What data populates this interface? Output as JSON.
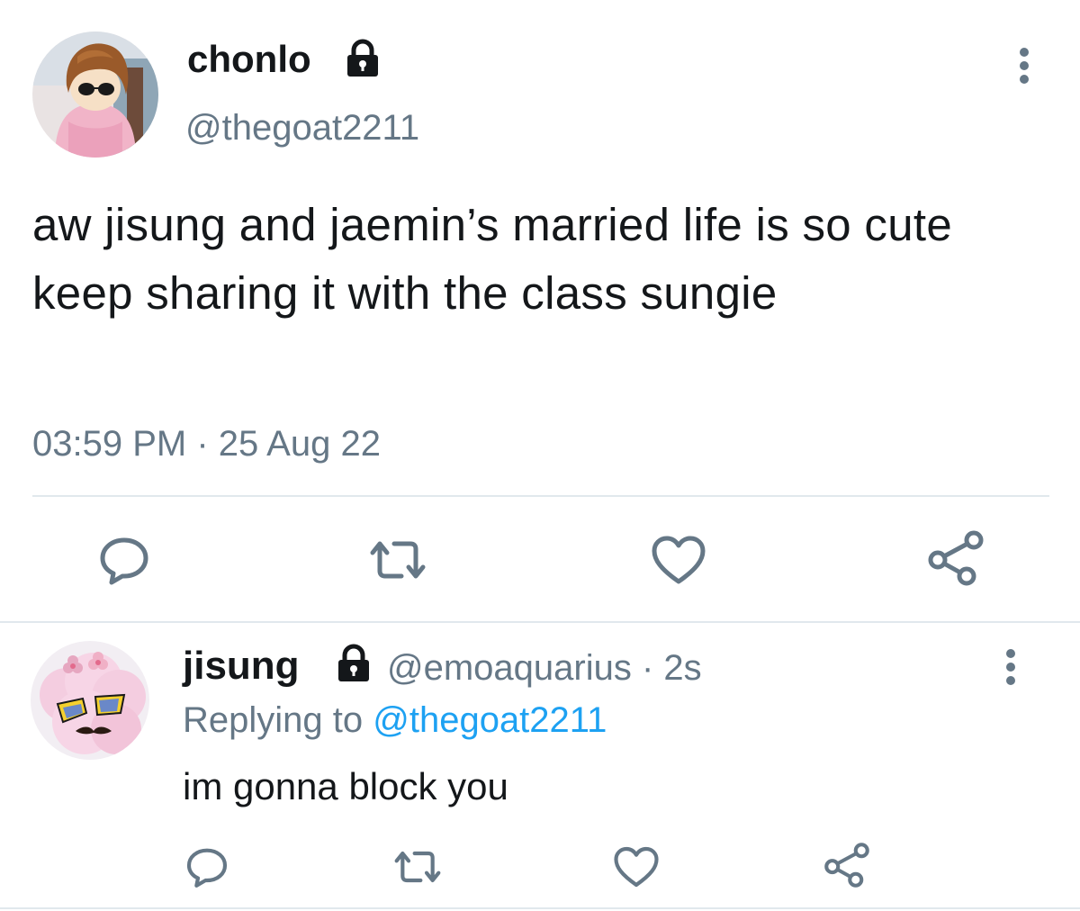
{
  "main_tweet": {
    "display_name": "chonlo",
    "handle": "@thegoat2211",
    "locked_icon": "lock-icon",
    "text": "aw jisung and jaemin’s married life is so cute keep sharing it with the class sungie",
    "timestamp": "03:59 PM · 25 Aug 22",
    "actions": [
      "reply-icon",
      "retweet-icon",
      "like-icon",
      "share-icon"
    ]
  },
  "reply_tweet": {
    "display_name": "jisung",
    "handle_time": "@emoaquarius · 2s",
    "locked_icon": "lock-icon",
    "replying_prefix": "Replying to ",
    "replying_mention": "@thegoat2211",
    "text": "im gonna block you",
    "actions": [
      "reply-icon",
      "retweet-icon",
      "like-icon",
      "share-icon"
    ]
  },
  "colors": {
    "text": "#14171a",
    "secondary": "#657786",
    "link": "#1da1f2",
    "divider": "#e1e8ed",
    "background": "#ffffff"
  }
}
